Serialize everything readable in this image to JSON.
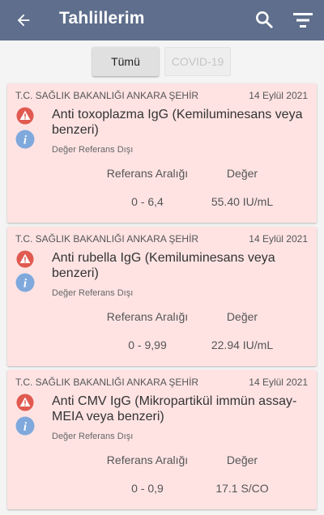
{
  "header": {
    "title": "Tahlillerim",
    "back_icon": "arrow-left-icon",
    "search_icon": "search-icon",
    "filter_icon": "filter-icon",
    "bg_color": "#5e6e8c"
  },
  "filters": {
    "all_label": "Tümü",
    "covid_label": "COVID-19",
    "selected": "Tümü"
  },
  "results": [
    {
      "institution": "T.C. SAĞLIK BAKANLIĞI ANKARA ŞEHİR",
      "date": "14 Eylül 2021",
      "test_name": "Anti toxoplazma IgG (Kemiluminesans veya benzeri)",
      "status": "Değer Referans Dışı",
      "range_header": "Referans Aralığı",
      "value_header": "Değer",
      "range": "0 - 6,4",
      "value": "55.40 IU/mL"
    },
    {
      "institution": "T.C. SAĞLIK BAKANLIĞI ANKARA ŞEHİR",
      "date": "14 Eylül 2021",
      "test_name": "Anti rubella IgG (Kemiluminesans veya benzeri)",
      "status": "Değer Referans Dışı",
      "range_header": "Referans Aralığı",
      "value_header": "Değer",
      "range": "0 - 9,99",
      "value": "22.94 IU/mL"
    },
    {
      "institution": "T.C. SAĞLIK BAKANLIĞI ANKARA ŞEHİR",
      "date": "14 Eylül 2021",
      "test_name": "Anti CMV IgG (Mikropartikül immün assay-MEIA veya benzeri)",
      "status": "Değer Referans Dışı",
      "range_header": "Referans Aralığı",
      "value_header": "Değer",
      "range": "0 - 0,9",
      "value": "17.1 S/CO"
    }
  ],
  "colors": {
    "card_bg": "#ffe3e3",
    "warning_red": "#e05a50",
    "info_blue": "#7fa9dd"
  }
}
